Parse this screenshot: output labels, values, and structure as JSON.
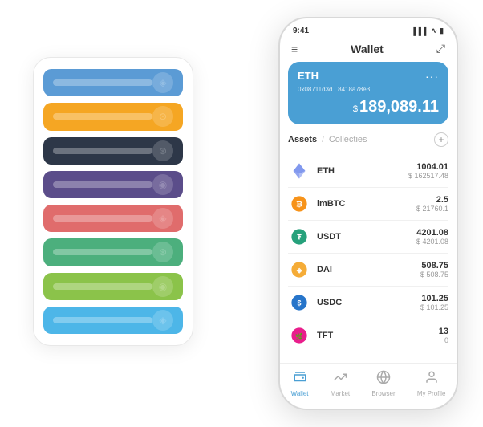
{
  "scene": {
    "bg_card": {
      "rows": [
        {
          "color": "row-blue",
          "id": "blue-row"
        },
        {
          "color": "row-orange",
          "id": "orange-row"
        },
        {
          "color": "row-dark",
          "id": "dark-row"
        },
        {
          "color": "row-purple",
          "id": "purple-row"
        },
        {
          "color": "row-red",
          "id": "red-row"
        },
        {
          "color": "row-green",
          "id": "green-row"
        },
        {
          "color": "row-light-green",
          "id": "light-green-row"
        },
        {
          "color": "row-sky",
          "id": "sky-row"
        }
      ]
    },
    "phone": {
      "status_bar": {
        "time": "9:41",
        "signal": "▌▌▌",
        "wifi": "WiFi",
        "battery": "🔋"
      },
      "header": {
        "menu_icon": "≡",
        "title": "Wallet",
        "expand_icon": "⤢"
      },
      "eth_card": {
        "symbol": "ETH",
        "address": "0x08711d3d...8418a78e3",
        "currency": "$",
        "amount": "189,089.11"
      },
      "assets_header": {
        "tab_active": "Assets",
        "separator": "/",
        "tab_inactive": "Collecties",
        "add_icon": "+"
      },
      "assets": [
        {
          "icon": "◈",
          "icon_class": "eth-icon",
          "name": "ETH",
          "amount": "1004.01",
          "usd": "$ 162517.48"
        },
        {
          "icon": "⊙",
          "icon_class": "imbtc-icon",
          "name": "imBTC",
          "amount": "2.5",
          "usd": "$ 21760.1"
        },
        {
          "icon": "₮",
          "icon_class": "usdt-icon",
          "name": "USDT",
          "amount": "4201.08",
          "usd": "$ 4201.08"
        },
        {
          "icon": "◈",
          "icon_class": "dai-icon",
          "name": "DAI",
          "amount": "508.75",
          "usd": "$ 508.75"
        },
        {
          "icon": "$",
          "icon_class": "usdc-icon",
          "name": "USDC",
          "amount": "101.25",
          "usd": "$ 101.25"
        },
        {
          "icon": "🌿",
          "icon_class": "tft-icon",
          "name": "TFT",
          "amount": "13",
          "usd": "0"
        }
      ],
      "bottom_nav": [
        {
          "icon": "👛",
          "label": "Wallet",
          "active": true
        },
        {
          "icon": "📈",
          "label": "Market",
          "active": false
        },
        {
          "icon": "🌐",
          "label": "Browser",
          "active": false
        },
        {
          "icon": "👤",
          "label": "My Profile",
          "active": false
        }
      ]
    }
  }
}
